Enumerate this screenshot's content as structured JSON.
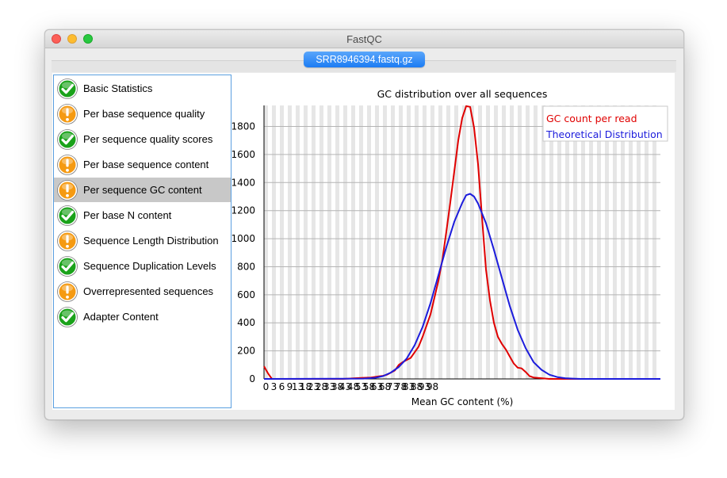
{
  "window": {
    "title": "FastQC"
  },
  "tab": {
    "label": "SRR8946394.fastq.gz"
  },
  "modules": [
    {
      "label": "Basic Statistics",
      "status": "pass",
      "icon": "check-icon"
    },
    {
      "label": "Per base sequence quality",
      "status": "warn",
      "icon": "warning-icon"
    },
    {
      "label": "Per sequence quality scores",
      "status": "pass",
      "icon": "check-icon"
    },
    {
      "label": "Per base sequence content",
      "status": "warn",
      "icon": "warning-icon"
    },
    {
      "label": "Per sequence GC content",
      "status": "warn",
      "icon": "warning-icon",
      "selected": true
    },
    {
      "label": "Per base N content",
      "status": "pass",
      "icon": "check-icon"
    },
    {
      "label": "Sequence Length Distribution",
      "status": "warn",
      "icon": "warning-icon"
    },
    {
      "label": "Sequence Duplication Levels",
      "status": "pass",
      "icon": "check-icon"
    },
    {
      "label": "Overrepresented sequences",
      "status": "warn",
      "icon": "warning-icon"
    },
    {
      "label": "Adapter Content",
      "status": "pass",
      "icon": "check-icon"
    }
  ],
  "colors": {
    "pass": "#1aa21a",
    "warn": "#f59a12",
    "gc_count": "#e00000",
    "theoretical": "#1c1cdc",
    "tab": "#2a86f5"
  },
  "chart_data": {
    "type": "line",
    "title": "GC distribution over all sequences",
    "xlabel": "Mean GC content (%)",
    "ylabel": "",
    "xlim": [
      0,
      100
    ],
    "ylim": [
      0,
      1950
    ],
    "x_tick_labels": [
      "0",
      "3",
      "6",
      "9",
      "13",
      "18",
      "23",
      "28",
      "33",
      "38",
      "43",
      "48",
      "53",
      "58",
      "63",
      "68",
      "73",
      "78",
      "83",
      "88",
      "93",
      "98"
    ],
    "y_ticks": [
      0,
      200,
      400,
      600,
      800,
      1000,
      1200,
      1400,
      1600,
      1800
    ],
    "grid": true,
    "legend_position": "top-right",
    "series": [
      {
        "name": "GC count per read",
        "color": "#e00000",
        "points": [
          [
            0,
            90
          ],
          [
            1,
            40
          ],
          [
            2,
            0
          ],
          [
            10,
            0
          ],
          [
            20,
            0
          ],
          [
            23,
            5
          ],
          [
            25,
            8
          ],
          [
            27,
            10
          ],
          [
            29,
            18
          ],
          [
            30,
            22
          ],
          [
            31,
            30
          ],
          [
            33,
            60
          ],
          [
            34,
            100
          ],
          [
            35,
            120
          ],
          [
            36,
            135
          ],
          [
            37,
            150
          ],
          [
            38,
            190
          ],
          [
            39,
            230
          ],
          [
            40,
            300
          ],
          [
            41,
            380
          ],
          [
            42,
            460
          ],
          [
            43,
            580
          ],
          [
            44,
            700
          ],
          [
            45,
            850
          ],
          [
            46,
            1050
          ],
          [
            47,
            1260
          ],
          [
            48,
            1480
          ],
          [
            49,
            1700
          ],
          [
            50,
            1860
          ],
          [
            51,
            1945
          ],
          [
            52,
            1940
          ],
          [
            53,
            1790
          ],
          [
            54,
            1530
          ],
          [
            55,
            1150
          ],
          [
            56,
            780
          ],
          [
            57,
            560
          ],
          [
            58,
            400
          ],
          [
            59,
            300
          ],
          [
            60,
            250
          ],
          [
            61,
            210
          ],
          [
            62,
            160
          ],
          [
            63,
            110
          ],
          [
            64,
            80
          ],
          [
            65,
            75
          ],
          [
            66,
            50
          ],
          [
            67,
            20
          ],
          [
            68,
            10
          ],
          [
            70,
            5
          ],
          [
            72,
            0
          ],
          [
            100,
            0
          ]
        ]
      },
      {
        "name": "Theoretical Distribution",
        "color": "#1c1cdc",
        "points": [
          [
            0,
            0
          ],
          [
            25,
            2
          ],
          [
            28,
            8
          ],
          [
            30,
            20
          ],
          [
            32,
            45
          ],
          [
            34,
            85
          ],
          [
            36,
            145
          ],
          [
            38,
            240
          ],
          [
            40,
            370
          ],
          [
            42,
            540
          ],
          [
            44,
            740
          ],
          [
            46,
            940
          ],
          [
            48,
            1120
          ],
          [
            50,
            1255
          ],
          [
            51,
            1310
          ],
          [
            52,
            1320
          ],
          [
            53,
            1300
          ],
          [
            54,
            1250
          ],
          [
            56,
            1110
          ],
          [
            58,
            920
          ],
          [
            60,
            720
          ],
          [
            62,
            520
          ],
          [
            64,
            350
          ],
          [
            66,
            220
          ],
          [
            68,
            120
          ],
          [
            70,
            65
          ],
          [
            72,
            30
          ],
          [
            74,
            13
          ],
          [
            76,
            5
          ],
          [
            78,
            2
          ],
          [
            80,
            0
          ],
          [
            100,
            0
          ]
        ]
      }
    ]
  }
}
